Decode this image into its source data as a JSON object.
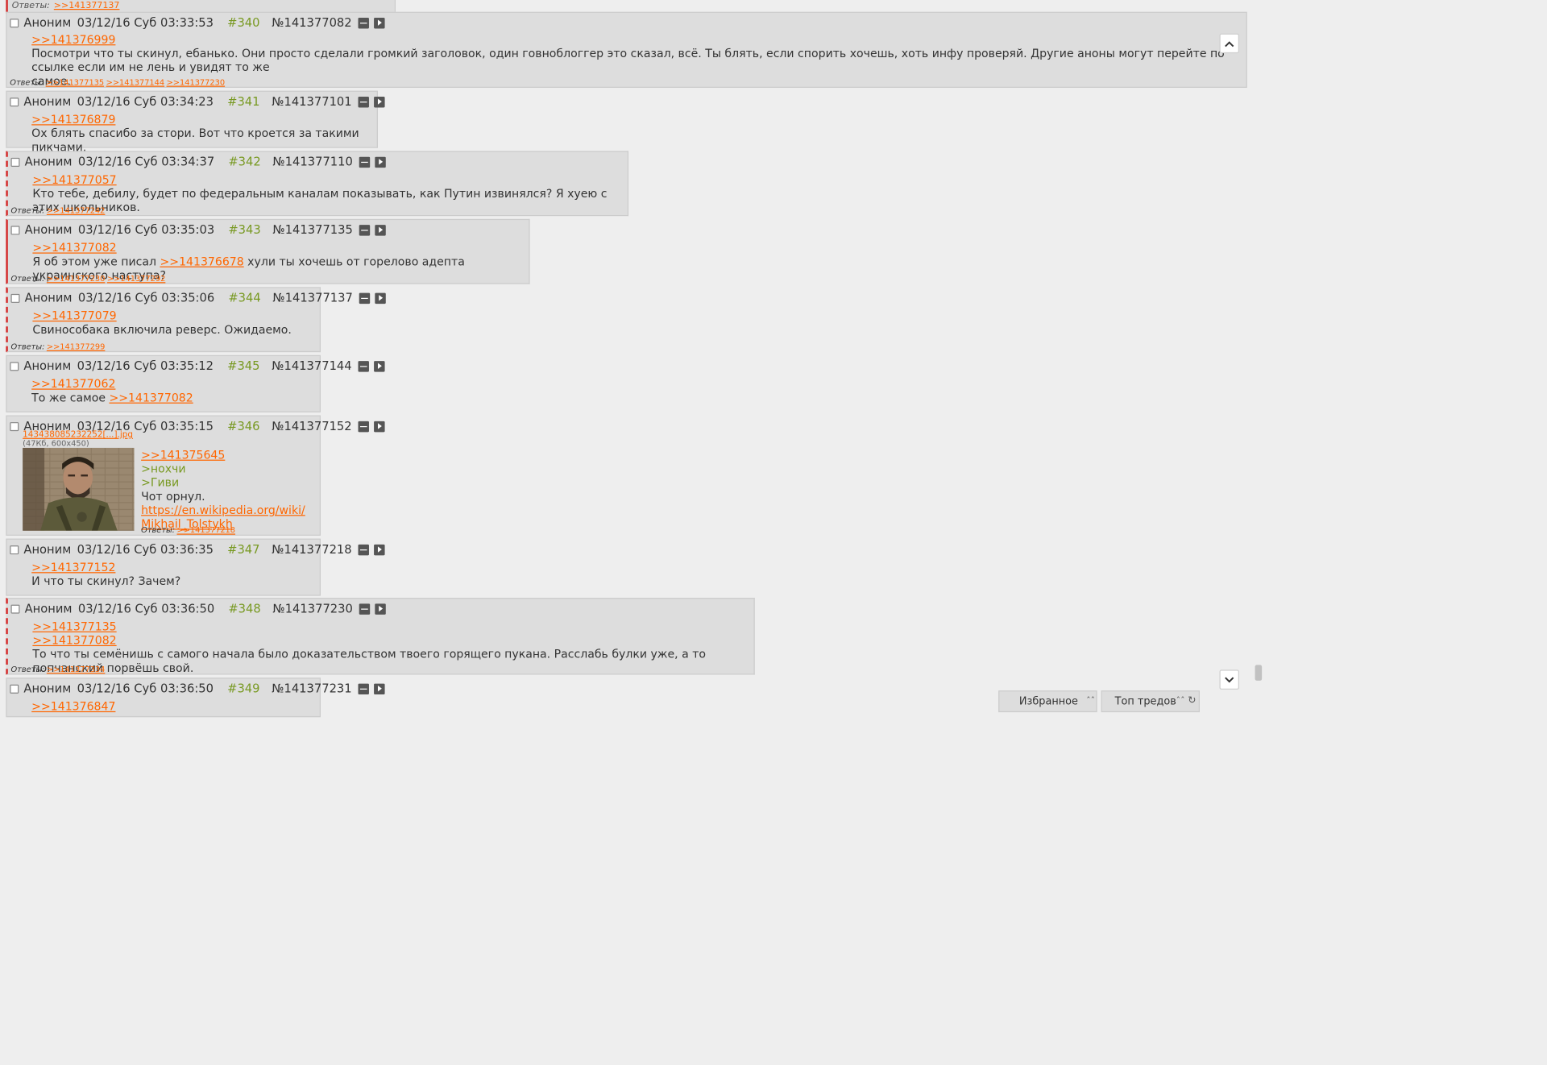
{
  "top_strip": {
    "replies_label": "Ответы:",
    "replies": [
      ">>141377137"
    ]
  },
  "posts": [
    {
      "name": "Аноним",
      "date": "03/12/16 Суб 03:33:53",
      "num": "#340",
      "postno": "№141377082",
      "lines": [
        [
          {
            "t": "link",
            "v": ">>141376999"
          }
        ],
        [
          {
            "t": "text",
            "v": "Посмотри что ты скинул, ебанько. Они просто сделали громкий заголовок, один говноблоггер это сказал, всё. Ты блять, если спорить хочешь, хоть инфу проверяй. Другие аноны могут перейте по ссылке если им не лень и увидят то же"
          }
        ],
        [
          {
            "t": "text",
            "v": "самое."
          }
        ]
      ],
      "replies_label": "Ответы:",
      "replies": [
        ">>141377135",
        ">>141377144",
        ">>141377230"
      ]
    },
    {
      "name": "Аноним",
      "date": "03/12/16 Суб 03:34:23",
      "num": "#341",
      "postno": "№141377101",
      "lines": [
        [
          {
            "t": "link",
            "v": ">>141376879"
          }
        ],
        [
          {
            "t": "text",
            "v": "Ох блять спасибо за стори. Вот что кроется за такими пикчами."
          }
        ]
      ],
      "replies_label": "",
      "replies": []
    },
    {
      "name": "Аноним",
      "date": "03/12/16 Суб 03:34:37",
      "num": "#342",
      "postno": "№141377110",
      "lines": [
        [
          {
            "t": "link",
            "v": ">>141377057"
          }
        ],
        [
          {
            "t": "text",
            "v": "Кто тебе, дебилу, будет по федеральным каналам показывать, как Путин извинялся? Я хуею с этих школьников."
          }
        ]
      ],
      "replies_label": "Ответы:",
      "replies": [
        ">>141377242"
      ]
    },
    {
      "name": "Аноним",
      "date": "03/12/16 Суб 03:35:03",
      "num": "#343",
      "postno": "№141377135",
      "lines": [
        [
          {
            "t": "link",
            "v": ">>141377082"
          }
        ],
        [
          {
            "t": "text",
            "v": "Я об этом уже писал "
          },
          {
            "t": "link",
            "v": ">>141376678"
          },
          {
            "t": "text",
            "v": " хули ты хочешь от горелово адепта украинского наступа?"
          }
        ]
      ],
      "replies_label": "Ответы:",
      "replies": [
        ">>141377230",
        ">>141377292"
      ]
    },
    {
      "name": "Аноним",
      "date": "03/12/16 Суб 03:35:06",
      "num": "#344",
      "postno": "№141377137",
      "lines": [
        [
          {
            "t": "link",
            "v": ">>141377079"
          }
        ],
        [
          {
            "t": "text",
            "v": "Свинособака включила реверс. Ожидаемо."
          }
        ]
      ],
      "replies_label": "Ответы:",
      "replies": [
        ">>141377299"
      ]
    },
    {
      "name": "Аноним",
      "date": "03/12/16 Суб 03:35:12",
      "num": "#345",
      "postno": "№141377144",
      "lines": [
        [
          {
            "t": "link",
            "v": ">>141377062"
          }
        ],
        [
          {
            "t": "text",
            "v": "То же самое "
          },
          {
            "t": "link",
            "v": ">>141377082"
          }
        ]
      ],
      "replies_label": "",
      "replies": []
    },
    {
      "name": "Аноним",
      "date": "03/12/16 Суб 03:35:15",
      "num": "#346",
      "postno": "№141377152",
      "file": {
        "name": "143438085232252[...].jpg",
        "meta": "(47Кб, 600x450)"
      },
      "lines": [
        [
          {
            "t": "link",
            "v": ">>141375645"
          }
        ],
        [
          {
            "t": "quote",
            "v": ">нохчи"
          }
        ],
        [
          {
            "t": "quote",
            "v": ">Гиви"
          }
        ],
        [
          {
            "t": "text",
            "v": "Чот орнул."
          }
        ],
        [
          {
            "t": "link",
            "v": "https://en.wikipedia.org/wiki/"
          }
        ],
        [
          {
            "t": "link",
            "v": "Mikhail_Tolstykh"
          }
        ]
      ],
      "replies_label": "Ответы:",
      "replies": [
        ">>141377218"
      ]
    },
    {
      "name": "Аноним",
      "date": "03/12/16 Суб 03:36:35",
      "num": "#347",
      "postno": "№141377218",
      "lines": [
        [
          {
            "t": "link",
            "v": ">>141377152"
          }
        ],
        [
          {
            "t": "text",
            "v": "И что ты скинул? Зачем?"
          }
        ]
      ],
      "replies_label": "",
      "replies": []
    },
    {
      "name": "Аноним",
      "date": "03/12/16 Суб 03:36:50",
      "num": "#348",
      "postno": "№141377230",
      "lines": [
        [
          {
            "t": "link",
            "v": ">>141377135"
          }
        ],
        [
          {
            "t": "link",
            "v": ">>141377082"
          }
        ],
        [
          {
            "t": "text",
            "v": "То что ты семёнишь с самого начала было доказательством твоего горящего пукана. Расслабь булки уже, а то попчанский порвёшь свой."
          }
        ]
      ],
      "replies_label": "Ответы:",
      "replies": [
        ">>141377334"
      ]
    },
    {
      "name": "Аноним",
      "date": "03/12/16 Суб 03:36:50",
      "num": "#349",
      "postno": "№141377231",
      "lines": [
        [
          {
            "t": "link",
            "v": ">>141376847"
          }
        ]
      ],
      "replies_label": "",
      "replies": []
    }
  ],
  "nav": {
    "up_icon": "chevron-up-icon",
    "down_icon": "chevron-down-icon"
  },
  "bottom": {
    "favorites": "Избранное",
    "top_threads": "Топ тредов"
  },
  "colors": {
    "link": "#ff6600",
    "quote": "#789922",
    "post_bg": "#dddddd",
    "page_bg": "#eeeeee",
    "marker": "#d42a2a"
  }
}
